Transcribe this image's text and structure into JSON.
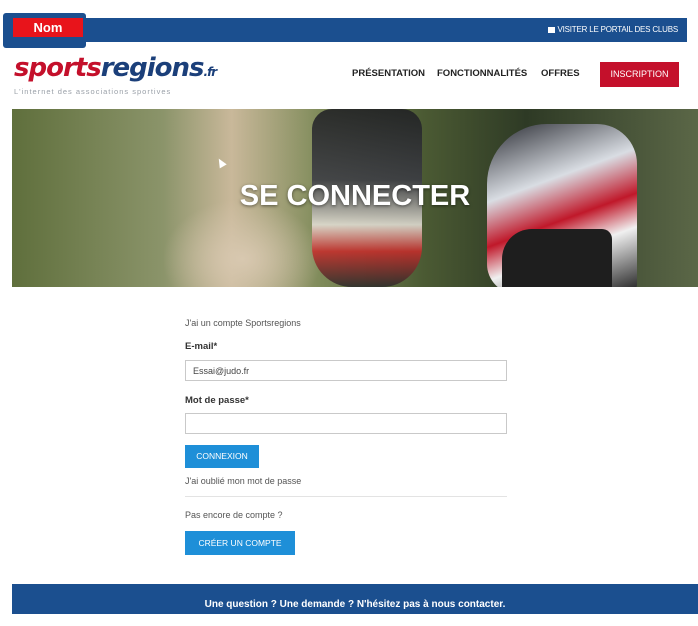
{
  "annotation_tag": "Nom",
  "topbar": {
    "portal_link": "VISITER LE PORTAIL DES CLUBS"
  },
  "logo": {
    "name_part1": "sports",
    "name_part2": "regions",
    "suffix": ".fr",
    "tagline": "L'internet des associations sportives"
  },
  "nav": {
    "items": [
      "PRÉSENTATION",
      "FONCTIONNALITÉS",
      "OFFRES"
    ],
    "cta": "INSCRIPTION"
  },
  "hero": {
    "title": "SE CONNECTER"
  },
  "login": {
    "intro": "J'ai un compte Sportsregions",
    "email_label": "E-mail*",
    "email_value": "Essai@judo.fr",
    "password_label": "Mot de passe*",
    "password_value": "",
    "submit": "CONNEXION",
    "forgot": "J'ai oublié mon mot de passe",
    "no_account": "Pas encore de compte ?",
    "create": "CRÉER UN COMPTE"
  },
  "footer": {
    "text": "Une question ? Une demande ? N'hésitez pas à nous contacter."
  },
  "colors": {
    "brand_blue": "#1b4f8f",
    "brand_red": "#c4102b",
    "button_blue": "#1e8fd8",
    "tag_red": "#e8141b"
  }
}
